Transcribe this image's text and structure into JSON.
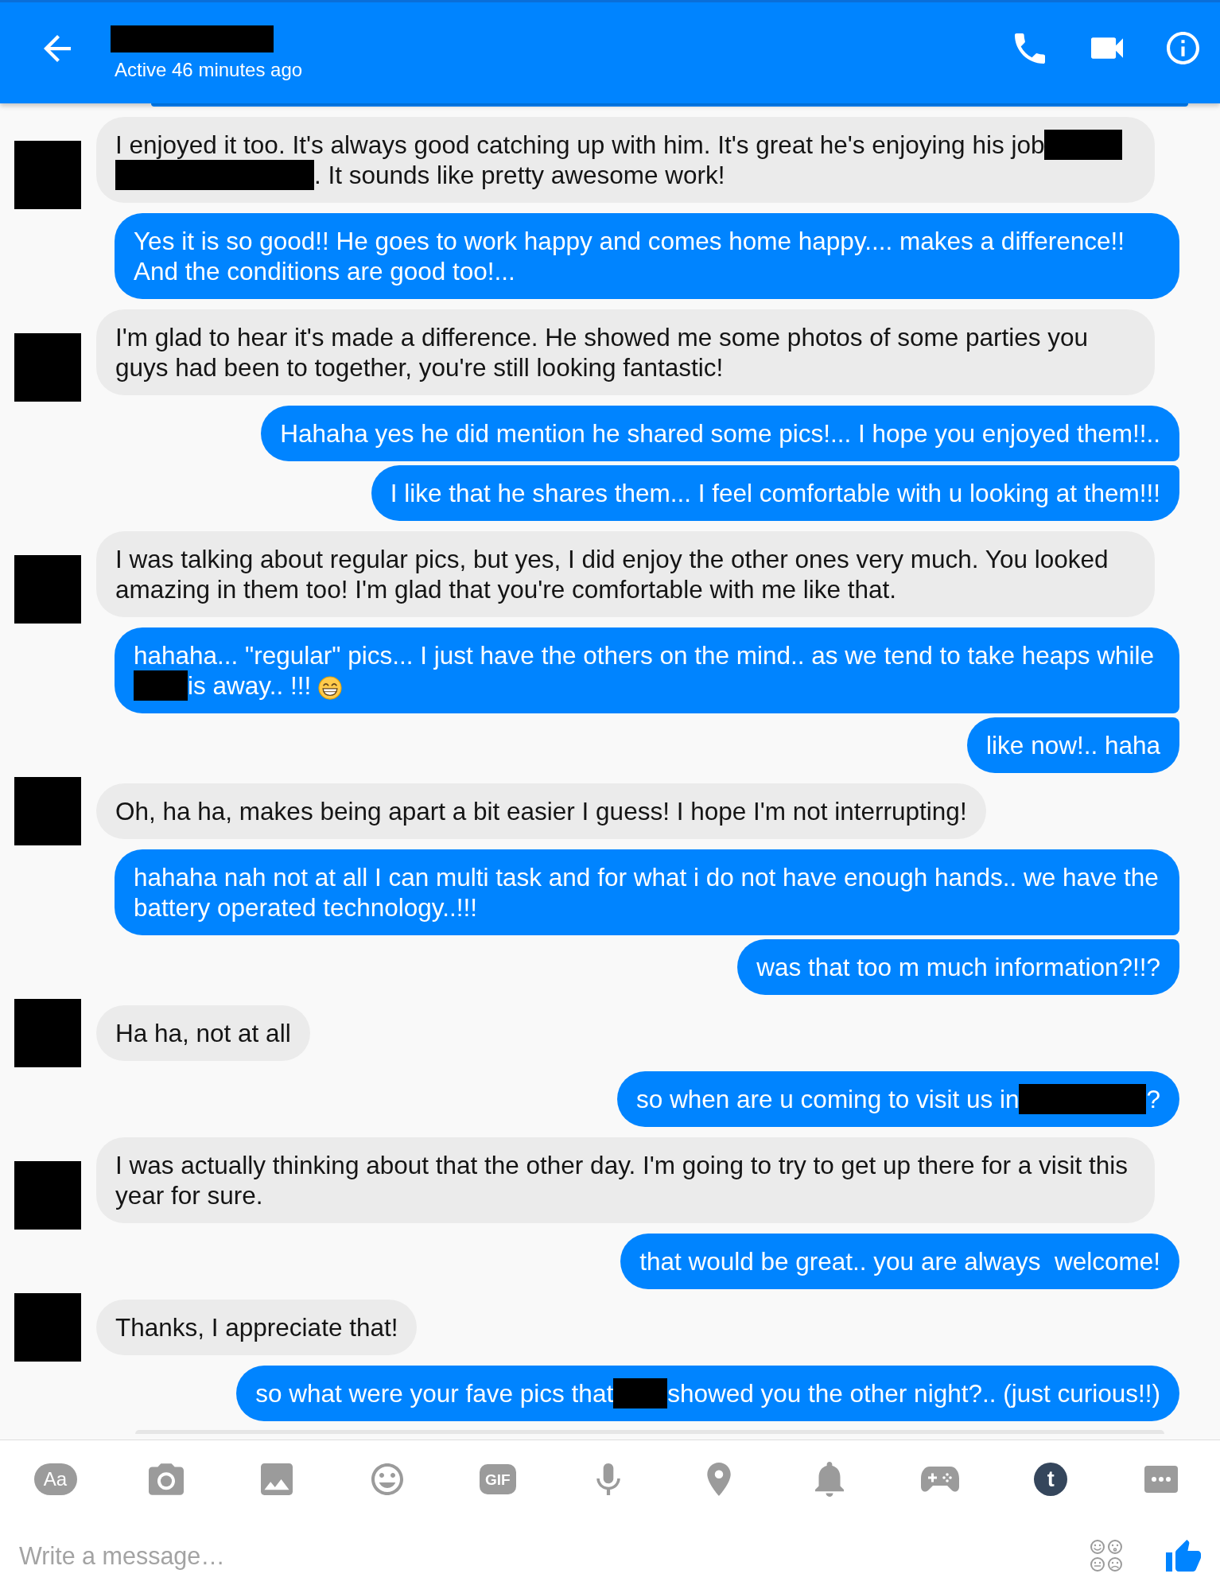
{
  "header": {
    "title": [
      {
        "kind": "wide-redaction"
      }
    ],
    "status": "Active 46 minutes ago"
  },
  "messages": [
    {
      "kind": "outgoing",
      "clipped": true
    },
    {
      "kind": "incoming",
      "clipped": false,
      "parts": [
        {
          "kind": "text",
          "text": "I enjoyed it too. It's always good catching up with him. It's great he's enjoying his job"
        },
        {
          "kind": "short-redaction"
        },
        {
          "kind": "long-redaction"
        },
        {
          "kind": "text",
          "text": ". It sounds like pretty awesome work!"
        }
      ]
    },
    {
      "kind": "outgoing",
      "clipped": false,
      "parts": [
        {
          "kind": "text",
          "text": "Yes it is so good!! He goes to work happy and comes home happy.... makes a difference!! And the conditions are good too!..."
        }
      ]
    },
    {
      "kind": "incoming",
      "clipped": false,
      "parts": [
        {
          "kind": "text",
          "text": "I'm glad to hear it's made a difference. He showed me some photos of some parties you guys had been to together, you're still looking fantastic!"
        }
      ]
    },
    {
      "kind": "outgoing",
      "clipped": false,
      "parts": [
        {
          "kind": "text",
          "text": "Hahaha yes he did mention he shared some pics!... I hope you enjoyed them!!.."
        }
      ]
    },
    {
      "kind": "outgoing",
      "clipped": false,
      "parts": [
        {
          "kind": "text",
          "text": "I like that he shares them... I feel comfortable with u looking at them!!!"
        }
      ]
    },
    {
      "kind": "incoming",
      "clipped": false,
      "parts": [
        {
          "kind": "text",
          "text": "I was talking about regular pics, but yes, I did enjoy the other ones very much. You looked amazing in them too! I'm glad that you're comfortable with me like that."
        }
      ]
    },
    {
      "kind": "outgoing",
      "clipped": false,
      "parts": [
        {
          "kind": "text",
          "text": "hahaha... \"regular\" pics... I just have the others on the mind.. as we tend to take heaps while "
        },
        {
          "kind": "tiny-redaction"
        },
        {
          "kind": "text",
          "text": "is away.. !!! "
        },
        {
          "kind": "emoji"
        }
      ]
    },
    {
      "kind": "outgoing",
      "clipped": false,
      "parts": [
        {
          "kind": "text",
          "text": "like now!.. haha"
        }
      ]
    },
    {
      "kind": "incoming",
      "clipped": false,
      "parts": [
        {
          "kind": "text",
          "text": "Oh, ha ha, makes being apart a bit easier I guess! I hope I'm not interrupting!"
        }
      ]
    },
    {
      "kind": "outgoing",
      "clipped": false,
      "parts": [
        {
          "kind": "text",
          "text": "hahaha nah not at all I can multi task and for what i do not have enough hands.. we have the battery operated technology..!!!"
        }
      ]
    },
    {
      "kind": "outgoing",
      "clipped": false,
      "parts": [
        {
          "kind": "text",
          "text": "was that too m much information?!!?"
        }
      ]
    },
    {
      "kind": "incoming",
      "clipped": false,
      "parts": [
        {
          "kind": "text",
          "text": "Ha ha, not at all"
        }
      ]
    },
    {
      "kind": "outgoing",
      "clipped": false,
      "parts": [
        {
          "kind": "text",
          "text": "so when are u coming to visit us in"
        },
        {
          "kind": "medium-redaction"
        },
        {
          "kind": "text",
          "text": "?"
        }
      ]
    },
    {
      "kind": "incoming",
      "clipped": false,
      "parts": [
        {
          "kind": "text",
          "text": "I was actually thinking about that the other day. I'm going to try to get up there for a visit this year for sure."
        }
      ]
    },
    {
      "kind": "outgoing",
      "clipped": false,
      "parts": [
        {
          "kind": "text",
          "text": "that would be great.. you are always  welcome!"
        }
      ]
    },
    {
      "kind": "incoming",
      "clipped": false,
      "parts": [
        {
          "kind": "text",
          "text": "Thanks, I appreciate that!"
        }
      ]
    },
    {
      "kind": "outgoing",
      "clipped": false,
      "parts": [
        {
          "kind": "text",
          "text": "so what were your fave pics that"
        },
        {
          "kind": "tiny-redaction"
        },
        {
          "kind": "text",
          "text": "showed you the other night?.. (just curious!!)"
        }
      ]
    },
    {
      "kind": "incoming",
      "clipped": true
    }
  ],
  "toolbar": [
    {
      "kind": "text-style",
      "label": "Aa"
    },
    {
      "kind": "camera"
    },
    {
      "kind": "gallery"
    },
    {
      "kind": "emoji"
    },
    {
      "kind": "gif",
      "label": "GIF"
    },
    {
      "kind": "microphone"
    },
    {
      "kind": "location"
    },
    {
      "kind": "bell"
    },
    {
      "kind": "game"
    },
    {
      "kind": "letter-logo",
      "label": "t"
    },
    {
      "kind": "more"
    }
  ],
  "composer": {
    "placeholder": "Write a message…"
  }
}
